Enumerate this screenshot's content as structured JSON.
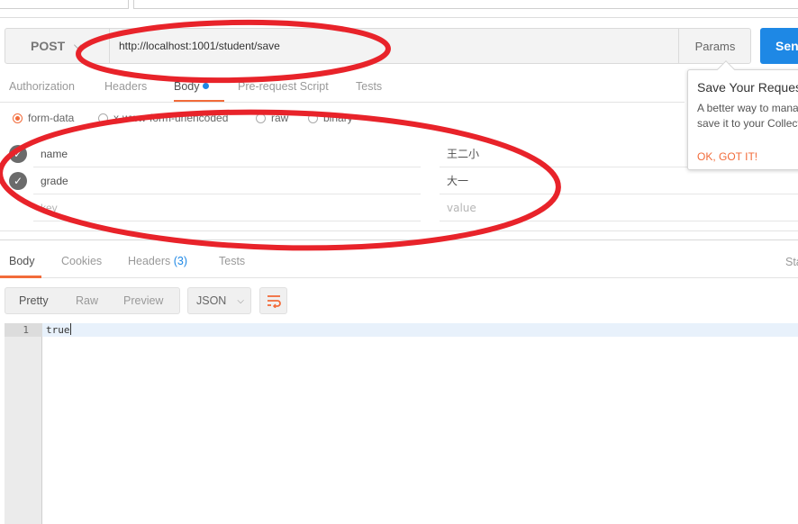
{
  "request": {
    "method": "POST",
    "url": "http://localhost:1001/student/save",
    "params_label": "Params",
    "send_label": "Send"
  },
  "request_tabs": [
    {
      "label": "Authorization",
      "active": false
    },
    {
      "label": "Headers",
      "active": false
    },
    {
      "label": "Body",
      "active": true,
      "indicator": true
    },
    {
      "label": "Pre-request Script",
      "active": false
    },
    {
      "label": "Tests",
      "active": false
    }
  ],
  "body_types": [
    {
      "label": "form-data",
      "selected": true
    },
    {
      "label": "x-www-form-urlencoded",
      "selected": false
    },
    {
      "label": "raw",
      "selected": false
    },
    {
      "label": "binary",
      "selected": false
    }
  ],
  "form_rows": [
    {
      "key": "name",
      "value": "王二小",
      "checked": true
    },
    {
      "key": "grade",
      "value": "大一",
      "checked": true
    }
  ],
  "new_row": {
    "key_placeholder": "key",
    "value_placeholder": "value"
  },
  "response_tabs": [
    {
      "label": "Body",
      "active": true
    },
    {
      "label": "Cookies",
      "active": false
    },
    {
      "label": "Headers",
      "count": "(3)",
      "active": false
    },
    {
      "label": "Tests",
      "active": false
    }
  ],
  "status_fragment": "Sta",
  "view_modes": [
    {
      "label": "Pretty",
      "active": true
    },
    {
      "label": "Raw",
      "active": false
    },
    {
      "label": "Preview",
      "active": false
    }
  ],
  "format": "JSON",
  "response_lines": [
    {
      "number": "1",
      "text": "true"
    }
  ],
  "tooltip": {
    "title": "Save Your Request",
    "text": "A better way to manage\nsave it to your Collection",
    "ok_label": "OK, GOT IT!"
  },
  "colors": {
    "accent": "#f26b3a",
    "send": "#1e88e5",
    "annotation": "#e8232a"
  },
  "icons": {
    "method_caret": "chevron-down-icon",
    "format_caret": "chevron-down-icon",
    "wrap": "wrap-lines-icon",
    "row_check": "check-circle-icon"
  }
}
